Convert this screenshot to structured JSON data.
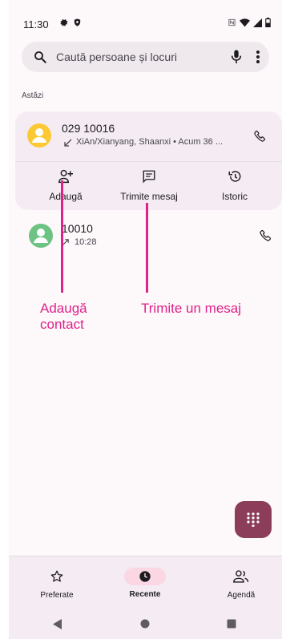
{
  "status_bar": {
    "time": "11:30"
  },
  "search": {
    "placeholder": "Caută persoane și locuri"
  },
  "section": {
    "today": "Astăzi"
  },
  "calls": [
    {
      "name": "029 10016",
      "detail": "XiAn/Xianyang, Shaanxi • Acum 36 ...",
      "avatar_color": "#fcc934",
      "direction": "missed-incoming"
    },
    {
      "name": "10010",
      "detail": "10:28",
      "avatar_color": "#6cc383",
      "direction": "outgoing"
    }
  ],
  "actions": {
    "add": "Adaugă",
    "message": "Trimite mesaj",
    "history": "Istoric"
  },
  "annotations": {
    "add_contact_line1": "Adaugă",
    "add_contact_line2": "contact",
    "send_message": "Trimite un mesaj"
  },
  "bottom_nav": {
    "favorites": "Preferate",
    "recents": "Recente",
    "contacts": "Agendă"
  },
  "colors": {
    "accent_annotation": "#e0218a",
    "fab": "#8b3d5a",
    "active_pill": "#fbd7e4"
  }
}
